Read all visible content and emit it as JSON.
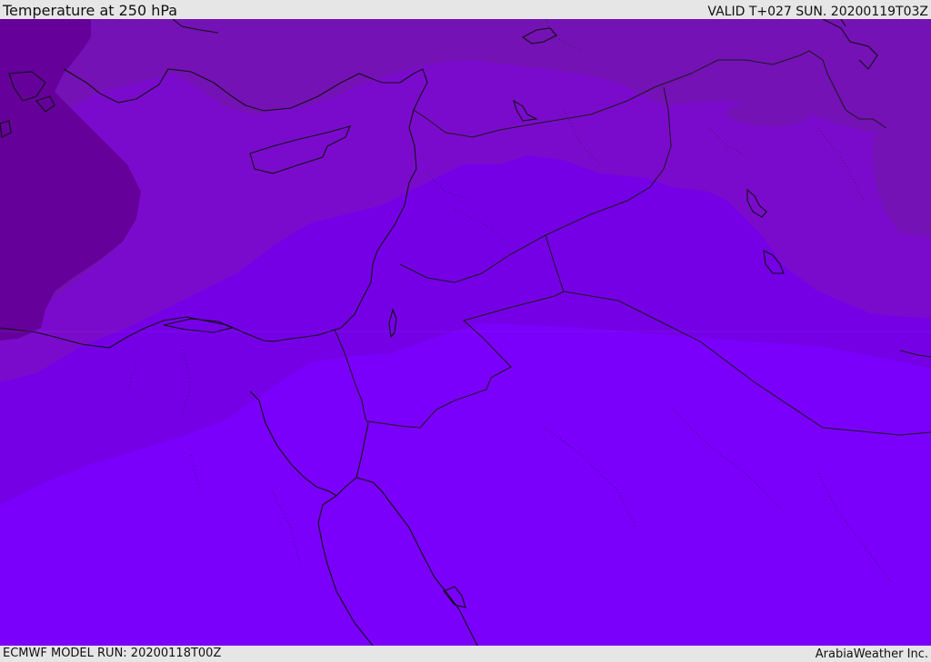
{
  "header": {
    "title": "Temperature at 250 hPa",
    "valid": "VALID T+027 SUN. 20200119T03Z"
  },
  "footer": {
    "model_run": "ECMWF MODEL RUN: 20200118T00Z",
    "credit": "ArabiaWeather Inc."
  },
  "map": {
    "region": "Eastern Mediterranean and Middle East",
    "field": "temperature",
    "colors": {
      "darkest_band": "#65009a",
      "dark_band": "#7412b5",
      "mid_band": "#7b0bcc",
      "light_band": "#7500e6",
      "lightest_band": "#7a00fb",
      "coastline": "#111111",
      "border": "#222222"
    }
  }
}
